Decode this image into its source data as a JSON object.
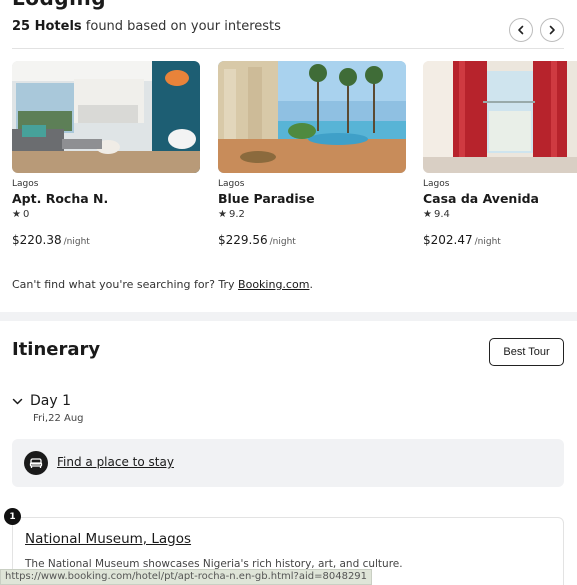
{
  "lodging": {
    "title_clipped": "Lodging",
    "found_count": "25 Hotels",
    "found_text": " found based on your interests",
    "prev_icon": "chevron-left-icon",
    "next_icon": "chevron-right-icon",
    "hotels": [
      {
        "city": "Lagos",
        "name": "Apt. Rocha N.",
        "rating": "0",
        "price": "$220.38",
        "unit": "/night"
      },
      {
        "city": "Lagos",
        "name": "Blue Paradise",
        "rating": "9.2",
        "price": "$229.56",
        "unit": "/night"
      },
      {
        "city": "Lagos",
        "name": "Casa da Avenida",
        "rating": "9.4",
        "price": "$202.47",
        "unit": "/night"
      }
    ],
    "cant_find_text": "Can't find what you're searching for? Try ",
    "cant_find_link": "Booking.com",
    "cant_find_end": "."
  },
  "itinerary": {
    "title": "Itinerary",
    "best_tour": "Best Tour",
    "day_label": "Day 1",
    "day_date": "Fri,22 Aug",
    "stay_link": "Find a place to stay",
    "stop_number": "1",
    "stop_title": "National Museum, Lagos",
    "stop_desc": "The National Museum showcases Nigeria's rich history, art, and culture."
  },
  "status_bar": {
    "url": "https://www.booking.com/hotel/pt/apt-rocha-n.en-gb.html?aid=8048291"
  },
  "colors": {
    "accent_dark": "#1a1a1a",
    "panel_bg": "#f1f2f4",
    "border": "#e3e3e3"
  }
}
